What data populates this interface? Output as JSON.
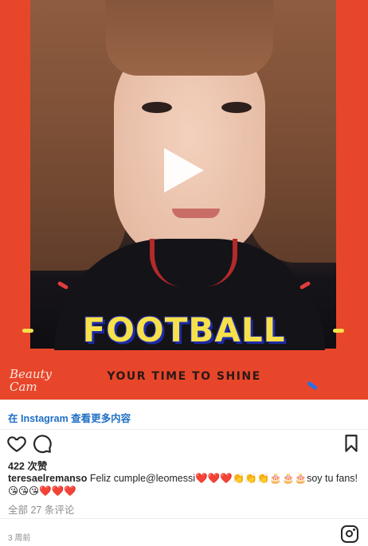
{
  "media": {
    "overlay_title": "FOOTBALL",
    "overlay_tagline": "YOUR TIME TO SHINE",
    "watermark": "Beauty Cam",
    "frame_color": "#e8462a"
  },
  "view_on_instagram": "在 Instagram 查看更多内容",
  "actions": {
    "like_icon": "heart-icon",
    "comment_icon": "comment-icon",
    "save_icon": "bookmark-icon"
  },
  "likes": "422 次赞",
  "caption": {
    "username": "teresaelremanso",
    "text": "Feliz cumple@leomessi❤️❤️❤️👏👏👏🎂🎂🎂soy tu fans! 😘😘😘❤️❤️❤️"
  },
  "all_comments": "全部 27 条评论",
  "timestamp": "3 周前",
  "accent_color": "#1f6fc5"
}
